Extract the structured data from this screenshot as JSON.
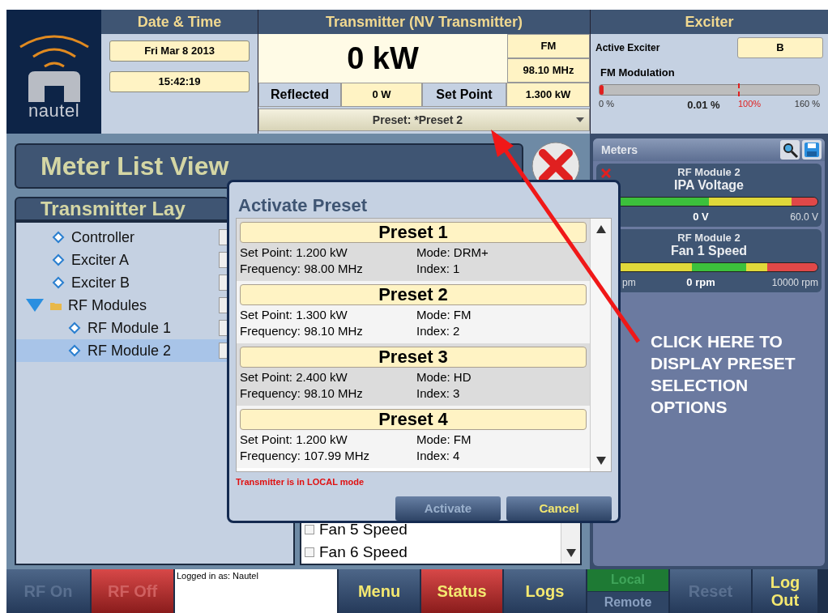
{
  "header": {
    "logo_text": "nautel",
    "date_time": {
      "title": "Date & Time",
      "date": "Fri Mar 8 2013",
      "time": "15:42:19"
    },
    "transmitter": {
      "title": "Transmitter (NV Transmitter)",
      "power": "0 kW",
      "mode": "FM",
      "frequency": "98.10 MHz",
      "reflected_label": "Reflected",
      "reflected": "0 W",
      "set_point_label": "Set Point",
      "set_point": "1.300 kW",
      "preset": "Preset: *Preset 2"
    },
    "exciter": {
      "title": "Exciter",
      "active_label": "Active Exciter",
      "active": "B",
      "modulation_label": "FM Modulation",
      "modulation": {
        "level": 0.02
      },
      "scale": [
        "0 %",
        "0.01 %",
        "100%",
        "160 %"
      ]
    }
  },
  "view_title": "Meter List View",
  "layout_title": "Transmitter Lay",
  "tree": [
    {
      "label": "Controller",
      "selected": false
    },
    {
      "label": "Exciter A",
      "selected": false
    },
    {
      "label": "Exciter B",
      "selected": false
    },
    {
      "label": "RF Modules",
      "selected": false,
      "expanded": true,
      "children": [
        {
          "label": "RF Module 1",
          "selected": false
        },
        {
          "label": "RF Module 2",
          "selected": true
        }
      ]
    }
  ],
  "meter_list": [
    {
      "label": "Fan 5 Speed",
      "checked": false
    },
    {
      "label": "Fan 6 Speed",
      "checked": false
    }
  ],
  "meters_panel": {
    "title": "Meters",
    "meters": [
      {
        "kind": "voltage",
        "module": "RF Module 2",
        "name": "IPA Voltage",
        "value": "0 V",
        "max": "60.0 V"
      },
      {
        "kind": "speed",
        "module": "RF Module 2",
        "name": "Fan 1 Speed",
        "min": "pm",
        "value": "0 rpm",
        "max": "10000 rpm"
      }
    ]
  },
  "bottom_bar": {
    "login": "Logged in as: Nautel",
    "buttons": [
      {
        "kind": "normal",
        "label": "RF On",
        "disabled": true
      },
      {
        "kind": "danger",
        "label": "RF Off",
        "disabled": true
      },
      {
        "kind": "login"
      },
      {
        "kind": "normal",
        "label": "Menu",
        "disabled": false
      },
      {
        "kind": "danger",
        "label": "Status",
        "disabled": false
      },
      {
        "kind": "normal",
        "label": "Logs",
        "disabled": false
      },
      {
        "kind": "toggle",
        "options": [
          {
            "label": "Local",
            "selected": true
          },
          {
            "label": "Remote",
            "selected": false
          }
        ]
      },
      {
        "kind": "normal",
        "label": "Reset",
        "disabled": true
      },
      {
        "kind": "normal",
        "label": "Log Out",
        "disabled": false
      }
    ]
  },
  "dialog": {
    "title": "Activate Preset",
    "presets": [
      {
        "name": "Preset 1",
        "set_point": "Set Point: 1.200 kW",
        "mode": "Mode: DRM+",
        "frequency": "Frequency: 98.00 MHz",
        "index": "Index: 1"
      },
      {
        "name": "Preset 2",
        "set_point": "Set Point: 1.300 kW",
        "mode": "Mode: FM",
        "frequency": "Frequency: 98.10 MHz",
        "index": "Index: 2"
      },
      {
        "name": "Preset 3",
        "set_point": "Set Point: 2.400 kW",
        "mode": "Mode: HD",
        "frequency": "Frequency: 98.10 MHz",
        "index": "Index: 3"
      },
      {
        "name": "Preset 4",
        "set_point": "Set Point: 1.200 kW",
        "mode": "Mode: FM",
        "frequency": "Frequency: 107.99 MHz",
        "index": "Index: 4"
      }
    ],
    "warning": "Transmitter is in LOCAL mode",
    "buttons": [
      {
        "label": "Activate",
        "disabled": true
      },
      {
        "label": "Cancel",
        "disabled": false
      }
    ]
  },
  "annotation": {
    "text": "CLICK HERE TO DISPLAY PRESET SELECTION OPTIONS"
  }
}
